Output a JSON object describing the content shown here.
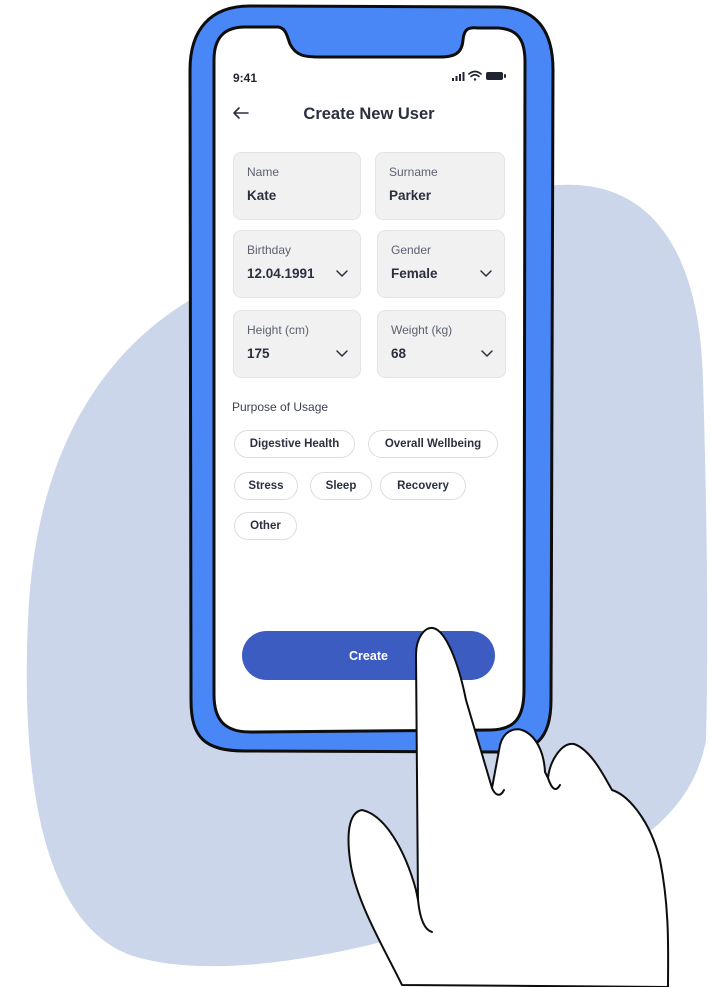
{
  "colors": {
    "backdrop_blob": "#ccd6ea",
    "phone_body": "#4a87f6",
    "outline": "#0d0d0d",
    "primary_button": "#3c5cc1",
    "field_background": "#f1f1f2"
  },
  "status_bar": {
    "time": "9:41",
    "icons": [
      "signal-icon",
      "wifi-icon",
      "battery-icon"
    ]
  },
  "header": {
    "back_icon": "arrow-left-icon",
    "title": "Create New User"
  },
  "form": {
    "name": {
      "label": "Name",
      "value": "Kate"
    },
    "surname": {
      "label": "Surname",
      "value": "Parker"
    },
    "birthday": {
      "label": "Birthday",
      "value": "12.04.1991"
    },
    "gender": {
      "label": "Gender",
      "value": "Female"
    },
    "height": {
      "label": "Height (cm)",
      "value": "175"
    },
    "weight": {
      "label": "Weight (kg)",
      "value": "68"
    }
  },
  "purpose": {
    "label": "Purpose of Usage",
    "options": [
      "Digestive Health",
      "Overall Wellbeing",
      "Stress",
      "Sleep",
      "Recovery",
      "Other"
    ]
  },
  "actions": {
    "create_label": "Create"
  }
}
